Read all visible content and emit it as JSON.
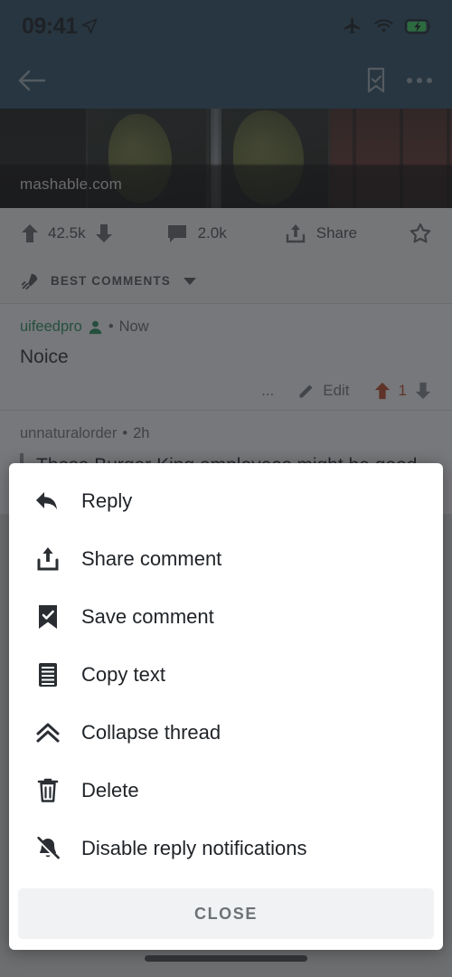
{
  "status_bar": {
    "time": "09:41",
    "icons": [
      "location-arrow-icon",
      "airplane-mode-icon",
      "wifi-icon",
      "battery-charging-icon"
    ],
    "battery_color": "#30d158"
  },
  "nav_bar": {
    "back_icon": "back-arrow-icon",
    "save_icon": "bookmark-check-icon",
    "overflow_icon": "overflow-menu-icon",
    "background": "#27495f"
  },
  "post": {
    "domain": "mashable.com",
    "upvotes": "42.5k",
    "comments_count": "2.0k",
    "share_label": "Share",
    "award_icon": "award-star-icon"
  },
  "sort_bar": {
    "icon": "rocket-icon",
    "label": "BEST COMMENTS",
    "caret": "chevron-down-icon"
  },
  "comments": [
    {
      "username": "uifeedpro",
      "is_op": true,
      "badge_icon": "user-badge-icon",
      "separator": "•",
      "timestamp": "Now",
      "body": "Noice",
      "overflow_label": "...",
      "edit_label": "Edit",
      "score": "1",
      "upvote_icon": "upvote-arrow-icon",
      "downvote_icon": "downvote-arrow-icon",
      "vote_color": "#b5411f"
    },
    {
      "username": "unnaturalorder",
      "is_op": false,
      "separator": "•",
      "timestamp": "2h",
      "body": "These Burger King employees might be good at"
    }
  ],
  "sheet": {
    "items": [
      {
        "label": "Reply",
        "icon": "reply-arrow-icon"
      },
      {
        "label": "Share comment",
        "icon": "share-upload-icon"
      },
      {
        "label": "Save comment",
        "icon": "bookmark-check-icon"
      },
      {
        "label": "Copy text",
        "icon": "copy-text-icon"
      },
      {
        "label": "Collapse thread",
        "icon": "chevron-double-up-icon"
      },
      {
        "label": "Delete",
        "icon": "trash-icon"
      },
      {
        "label": "Disable reply notifications",
        "icon": "bell-off-icon"
      }
    ],
    "close_label": "CLOSE"
  }
}
